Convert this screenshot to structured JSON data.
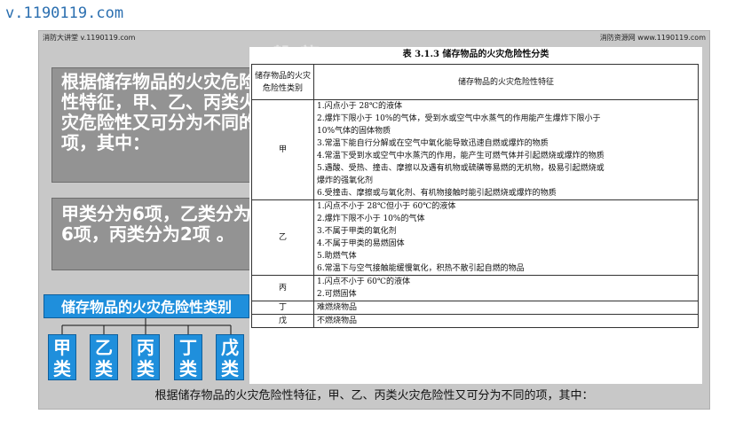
{
  "site_header": "v.1190119.com",
  "watermarks": {
    "left": "消防大讲堂 v.1190119.com",
    "right": "消防资源网 www.1190119.com"
  },
  "ghost_logo": "磐龍",
  "left_panel": {
    "intro": "根据储存物品的火灾危险性特征，甲、乙、丙类火灾危险性又可分为不同的项，其中：",
    "counts": "甲类分为6项，乙类分为6项，丙类分为2项 。",
    "category_title": "储存物品的火灾危险性类别",
    "categories": [
      {
        "c1": "甲",
        "c2": "类"
      },
      {
        "c1": "乙",
        "c2": "类"
      },
      {
        "c1": "丙",
        "c2": "类"
      },
      {
        "c1": "丁",
        "c2": "类"
      },
      {
        "c1": "戊",
        "c2": "类"
      }
    ]
  },
  "table": {
    "caption": "表 3.1.3  储存物品的火灾危险性分类",
    "header_class": "储存物品的火灾危险性类别",
    "header_feature": "储存物品的火灾危险性特征",
    "rows": [
      {
        "cls": "甲",
        "features": [
          "1.闪点小于 28℃的液体",
          "2.爆炸下限小于  10%的气体，受到水或空气中水蒸气的作用能产生爆炸下限小于",
          "10%气体的固体物质",
          "3.常温下能自行分解或在空气中氧化能导致迅速自燃或爆炸的物质",
          "4.常温下受到水或空气中水蒸汽的作用，能产生可燃气体并引起燃烧或爆炸的物质",
          "5.遇酸、受热、撞击、摩擦以及遇有机物或硫磺等易燃的无机物，极易引起燃烧或",
          "爆炸的强氧化剂",
          "6.受撞击、摩擦或与氧化剂、有机物接触时能引起燃烧或爆炸的物质"
        ]
      },
      {
        "cls": "乙",
        "features": [
          "1.闪点不小于 28℃但小于 60℃的液体",
          "2.爆炸下限不小于 10%的气体",
          "3.不属于甲类的氧化剂",
          "4.不属于甲类的易燃固体",
          "5.助燃气体",
          "6.常温下与空气接触能缓慢氧化，积热不散引起自燃的物品"
        ]
      },
      {
        "cls": "丙",
        "features": [
          "1.闪点不小于 60℃的液体",
          "2.可燃固体"
        ]
      },
      {
        "cls": "丁",
        "features": [
          "难燃烧物品"
        ]
      },
      {
        "cls": "戊",
        "features": [
          "不燃烧物品"
        ]
      }
    ]
  },
  "caption_bar": "根据储存物品的火灾危险性特征，甲、乙、丙类火灾危险性又可分为不同的项，其中："
}
